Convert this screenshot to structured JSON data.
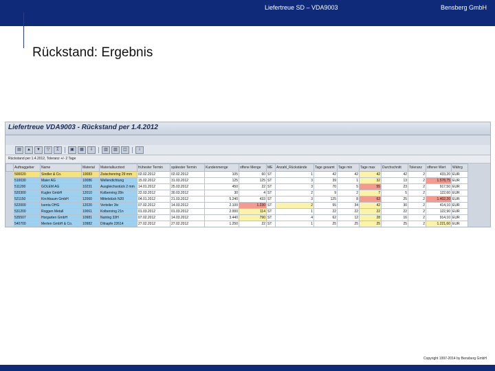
{
  "header": {
    "center_text": "Liefertreue SD – VDA9003",
    "right_text": "Bensberg GmbH"
  },
  "slide": {
    "title": "Rückstand: Ergebnis"
  },
  "sap": {
    "window_title": "Liefertreue VDA9003 - Rückstand per 1.4.2012",
    "info_line": "Rückstand per 1.4.2012, Toleranz +/- 2 Tage",
    "columns": [
      "Auftraggeber",
      "Name",
      "Material",
      "Materialkurztext",
      "frühester Termin",
      "spätester Termin",
      "Kundenmenge",
      "offene Menge",
      "ME",
      "Anzahl_Rückstände",
      "Tage gesamt",
      "Tage min",
      "Tage max",
      "Durchschnitt",
      "Toleranz",
      "offener Wert",
      "Währg"
    ],
    "rows": [
      [
        "500020",
        "Sindler & Co.",
        "10083",
        "Zwischenring 29 mm",
        "02.02.2012",
        "02.02.2012",
        "105",
        "60",
        "ST",
        "1",
        "42",
        "42",
        "42",
        "42",
        "2",
        "433,20",
        "EUR"
      ],
      [
        "510030",
        "Maier AG",
        "10086",
        "Wellendichtung",
        "15.02.2012",
        "31.03.2012",
        "125",
        "125",
        "ST",
        "3",
        "39",
        "1",
        "32",
        "13",
        "2",
        "1.578,75",
        "EUR"
      ],
      [
        "511200",
        "GOLEM AG",
        "10231",
        "Ausgleichsstück 2 mm",
        "14.01.2012",
        "25.03.2012",
        "450",
        "22",
        "ST",
        "3",
        "70",
        "5",
        "55",
        "23",
        "2",
        "917,50",
        "EUR"
      ],
      [
        "520300",
        "Kugler GmbH",
        "12010",
        "Kolbenring 28n",
        "22.03.2012",
        "30.03.2012",
        "30",
        "4",
        "ST",
        "2",
        "9",
        "2",
        "7",
        "5",
        "2",
        "122,60",
        "EUR"
      ],
      [
        "521150",
        "Kirchbaum GmbH",
        "12060",
        "Mittelstück N20",
        "04.01.2012",
        "21.03.2012",
        "5.240",
        "433",
        "ST",
        "3",
        "125",
        "8",
        "62",
        "25",
        "2",
        "1.402,20",
        "EUR"
      ],
      [
        "522000",
        "Isenta OHG",
        "12020",
        "Verteiler 3tv",
        "07.02.2012",
        "14.03.2012",
        "2.100",
        "1.230",
        "ST",
        "2",
        "55",
        "34",
        "42",
        "30",
        "2",
        "414,10",
        "EUR"
      ],
      [
        "531200",
        "Roggen Metall",
        "10061",
        "Kolbenring 21n",
        "01.03.2012",
        "01.03.2012",
        "2.000",
        "114",
        "ST",
        "1",
        "22",
        "22",
        "22",
        "22",
        "2",
        "122,90",
        "EUR"
      ],
      [
        "535507",
        "Horgarten GmbH",
        "10981",
        "Nutring 33H",
        "07.02.2012",
        "14.03.2012",
        "3.440",
        "790",
        "ST",
        "4",
        "62",
        "12",
        "28",
        "16",
        "2",
        "914,10",
        "EUR"
      ],
      [
        "540700",
        "Merten GmbH & Co.",
        "10982",
        "Dilnapfe 22614",
        "27.02.2012",
        "27.02.2012",
        "1.250",
        "22",
        "ST",
        "1",
        "25",
        "25",
        "25",
        "25",
        "2",
        "1.221,60",
        "EUR"
      ]
    ]
  },
  "footer": {
    "copyright": "Copyright 1997-2014 by Bensberg GmbH"
  },
  "colors": {
    "header_bar": "#0f2a78",
    "key_cell": "#9ed0f0",
    "selected_cell": "#f4e27a",
    "alert_red": "#f49a8f",
    "alert_yellow": "#fbf3a8"
  }
}
